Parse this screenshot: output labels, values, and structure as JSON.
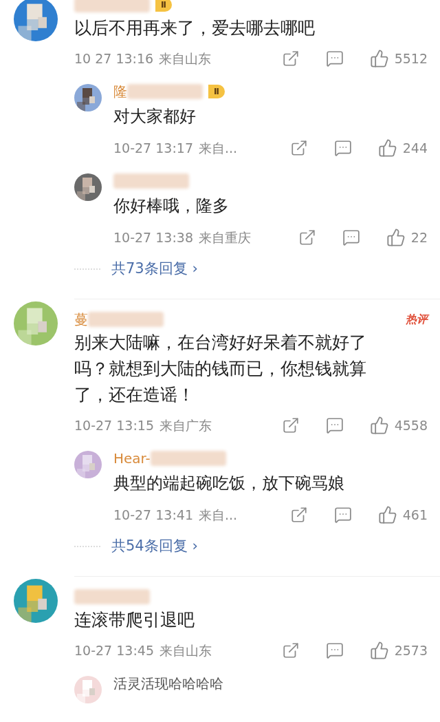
{
  "threads": [
    {
      "author": {
        "blurred": true,
        "level": "Ⅱ"
      },
      "text": "以后不用再来了，爱去哪去哪吧",
      "time": "10 27 13:16",
      "location": "来自山东",
      "likes": "5512",
      "replies": [
        {
          "author": {
            "blurred": true,
            "name": "隆",
            "level": "Ⅱ"
          },
          "text": "对大家都好",
          "time": "10-27 13:17",
          "location": "来自...",
          "likes": "244"
        },
        {
          "author": {
            "blurred": true
          },
          "text": "你好棒哦，隆多",
          "time": "10-27 13:38",
          "location": "来自重庆",
          "likes": "22"
        }
      ],
      "more": "共73条回复 ›"
    },
    {
      "author": {
        "blurred": true,
        "name": "蔓"
      },
      "hot_label": "热评",
      "text": "别来大陆嘛，在台湾好好呆着不就好了吗？就想到大陆的钱而已，你想钱就算了，还在造谣！",
      "time": "10-27 13:15",
      "location": "来自广东",
      "likes": "4558",
      "replies": [
        {
          "author": {
            "blurred": true,
            "name": "Hear-"
          },
          "text": "典型的端起碗吃饭，放下碗骂娘",
          "time": "10-27 13:41",
          "location": "来自...",
          "likes": "461"
        }
      ],
      "more": "共54条回复 ›"
    },
    {
      "author": {
        "blurred": true
      },
      "text": "连滚带爬引退吧",
      "time": "10-27 13:45",
      "location": "来自山东",
      "likes": "2573",
      "replies": [
        {
          "author": {
            "blurred": false,
            "name": "活灵活现哈哈哈哈"
          }
        }
      ]
    }
  ]
}
